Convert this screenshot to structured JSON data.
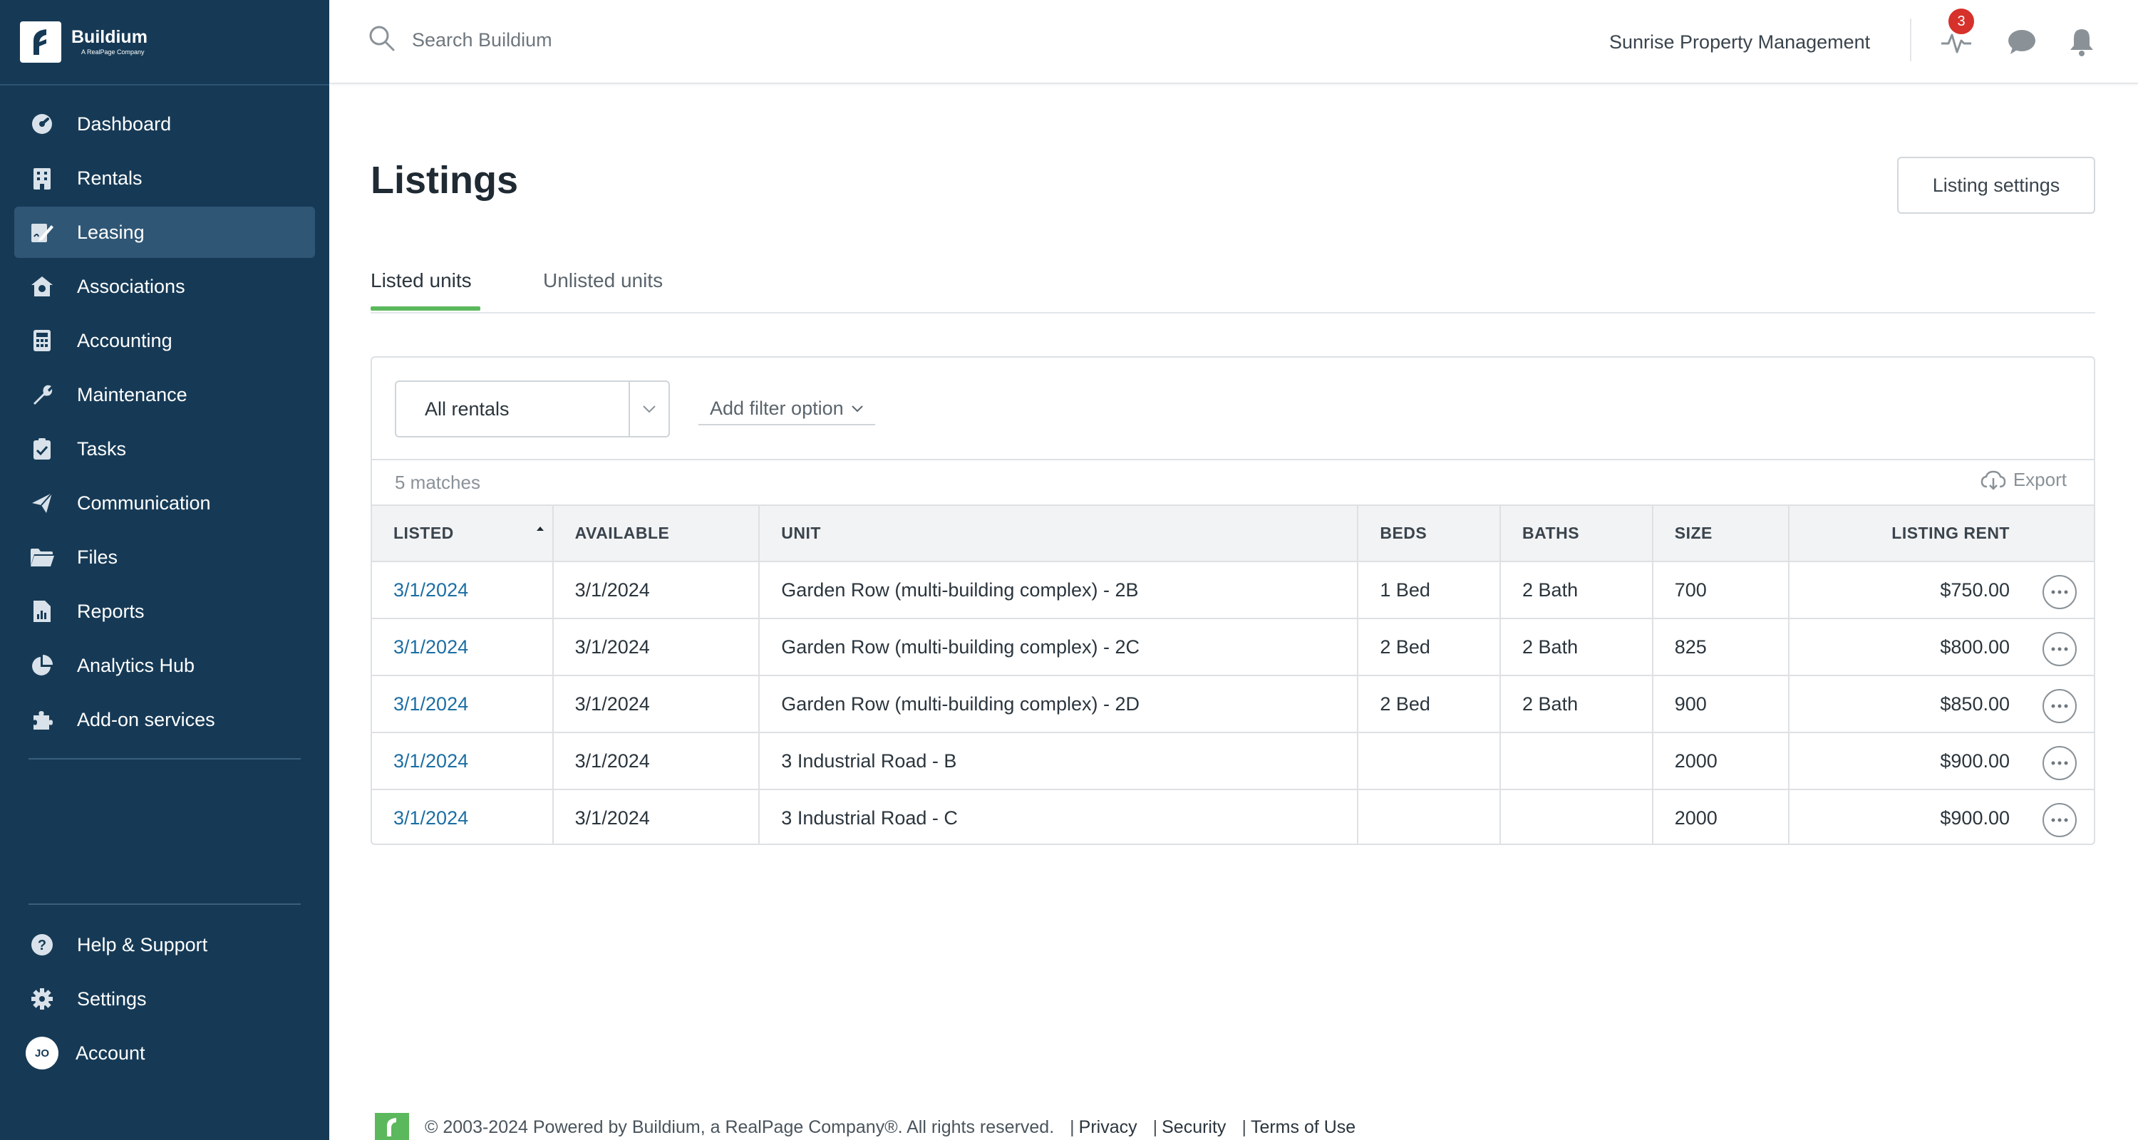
{
  "brand": {
    "name": "Buildium",
    "tagline": "A RealPage Company"
  },
  "sidebar": {
    "items": [
      {
        "label": "Dashboard",
        "icon": "dashboard-icon"
      },
      {
        "label": "Rentals",
        "icon": "building-icon"
      },
      {
        "label": "Leasing",
        "icon": "leasing-icon",
        "active": true
      },
      {
        "label": "Associations",
        "icon": "associations-icon"
      },
      {
        "label": "Accounting",
        "icon": "calculator-icon"
      },
      {
        "label": "Maintenance",
        "icon": "wrench-icon"
      },
      {
        "label": "Tasks",
        "icon": "clipboard-icon"
      },
      {
        "label": "Communication",
        "icon": "paper-plane-icon"
      },
      {
        "label": "Files",
        "icon": "folder-icon"
      },
      {
        "label": "Reports",
        "icon": "report-icon"
      },
      {
        "label": "Analytics Hub",
        "icon": "pie-chart-icon"
      },
      {
        "label": "Add-on services",
        "icon": "puzzle-icon"
      }
    ],
    "bottom": [
      {
        "label": "Help & Support",
        "icon": "help-icon"
      },
      {
        "label": "Settings",
        "icon": "gear-icon"
      },
      {
        "label": "Account",
        "icon": "avatar",
        "initials": "JO"
      }
    ]
  },
  "topbar": {
    "search_placeholder": "Search Buildium",
    "org_name": "Sunrise Property Management",
    "activity_badge": "3"
  },
  "main": {
    "title": "Listings",
    "settings_button": "Listing settings",
    "tabs": [
      {
        "label": "Listed units",
        "active": true
      },
      {
        "label": "Unlisted units"
      }
    ],
    "filter": {
      "rental_select": "All rentals",
      "add_filter": "Add filter option"
    },
    "matches": "5 matches",
    "export": "Export",
    "table": {
      "headers": [
        "LISTED",
        "AVAILABLE",
        "UNIT",
        "BEDS",
        "BATHS",
        "SIZE",
        "LISTING RENT"
      ],
      "rows": [
        {
          "listed": "3/1/2024",
          "available": "3/1/2024",
          "unit": "Garden Row (multi-building complex) - 2B",
          "beds": "1 Bed",
          "baths": "2 Bath",
          "size": "700",
          "rent": "$750.00"
        },
        {
          "listed": "3/1/2024",
          "available": "3/1/2024",
          "unit": "Garden Row (multi-building complex) - 2C",
          "beds": "2 Bed",
          "baths": "2 Bath",
          "size": "825",
          "rent": "$800.00"
        },
        {
          "listed": "3/1/2024",
          "available": "3/1/2024",
          "unit": "Garden Row (multi-building complex) - 2D",
          "beds": "2 Bed",
          "baths": "2 Bath",
          "size": "900",
          "rent": "$850.00"
        },
        {
          "listed": "3/1/2024",
          "available": "3/1/2024",
          "unit": "3 Industrial Road - B",
          "beds": "",
          "baths": "",
          "size": "2000",
          "rent": "$900.00"
        },
        {
          "listed": "3/1/2024",
          "available": "3/1/2024",
          "unit": "3 Industrial Road - C",
          "beds": "",
          "baths": "",
          "size": "2000",
          "rent": "$900.00"
        }
      ]
    }
  },
  "footer": {
    "copyright": "© 2003-2024 Powered by Buildium, a RealPage Company®. All rights reserved.",
    "links": [
      "Privacy",
      "Security",
      "Terms of Use"
    ]
  },
  "colors": {
    "sidebar_bg": "#163a56",
    "sidebar_active": "#2f5675",
    "accent_green": "#5cb85c",
    "link_blue": "#1c6ea4",
    "badge_red": "#d6312a"
  }
}
